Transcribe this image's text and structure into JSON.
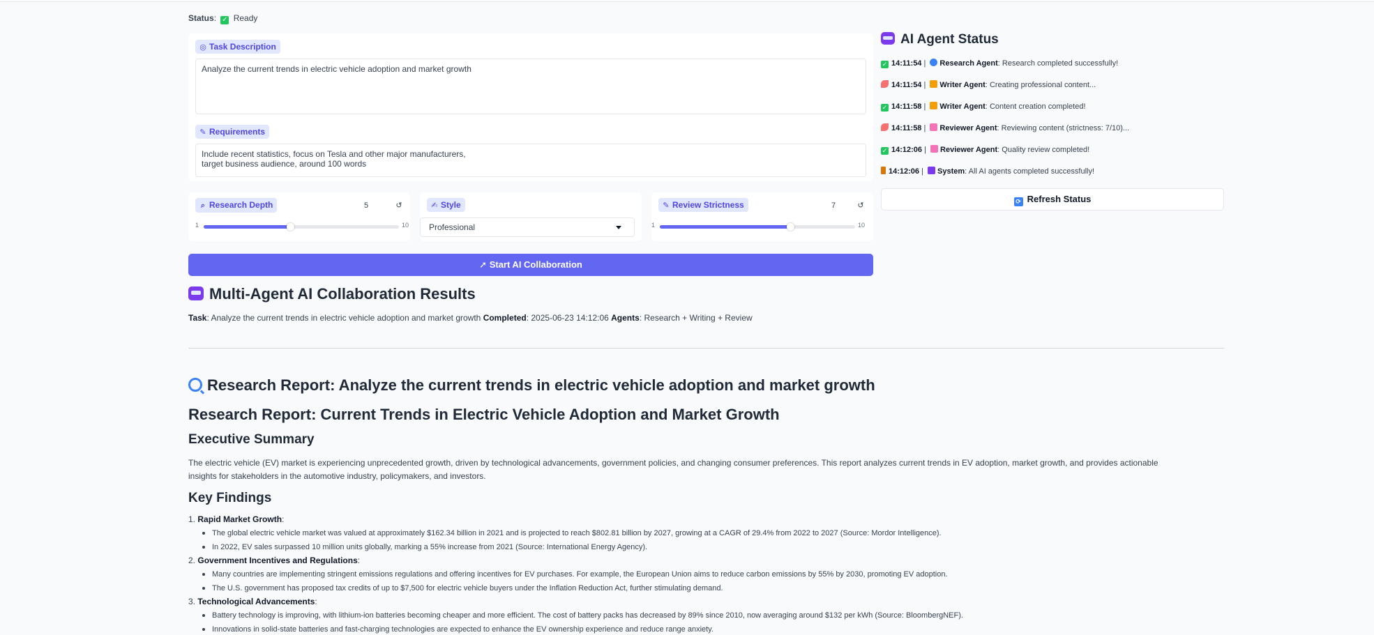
{
  "status": {
    "label": "Status",
    "value": "Ready",
    "icon": "checkmark-icon"
  },
  "task": {
    "label": "Task Description",
    "value": "Analyze the current trends in electric vehicle adoption and market growth"
  },
  "requirements": {
    "label": "Requirements",
    "line1": "Include recent statistics, focus on Tesla and other major manufacturers,",
    "line2": "target business audience, around 100 words"
  },
  "controls": {
    "research_depth": {
      "label": "Research Depth",
      "value": "5",
      "min": "1",
      "max": "10",
      "level": 5
    },
    "style": {
      "label": "Style",
      "selected": "Professional"
    },
    "review_strictness": {
      "label": "Review Strictness",
      "value": "7",
      "min": "1",
      "max": "10",
      "level": 7
    },
    "reset_icon": "↺"
  },
  "start_button": "Start AI Collaboration",
  "results": {
    "title": "Multi-Agent AI Collaboration Results",
    "task_label": "Task",
    "task_value": ": Analyze the current trends in electric vehicle adoption and market growth ",
    "completed_label": "Completed",
    "completed_value": ": 2025-06-23 14:12:06 ",
    "agents_label": "Agents",
    "agents_value": ": Research + Writing + Review"
  },
  "report": {
    "heading": "Research Report: Analyze the current trends in electric vehicle adoption and market growth",
    "title": "Research Report: Current Trends in Electric Vehicle Adoption and Market Growth",
    "exec_heading": "Executive Summary",
    "exec_text": "The electric vehicle (EV) market is experiencing unprecedented growth, driven by technological advancements, government policies, and changing consumer preferences. This report analyzes current trends in EV adoption, market growth, and provides actionable insights for stakeholders in the automotive industry, policymakers, and investors.",
    "findings_heading": "Key Findings",
    "findings": [
      {
        "num": "1.",
        "title": "Rapid Market Growth",
        "points": [
          "The global electric vehicle market was valued at approximately $162.34 billion in 2021 and is projected to reach $802.81 billion by 2027, growing at a CAGR of 29.4% from 2022 to 2027 (Source: Mordor Intelligence).",
          "In 2022, EV sales surpassed 10 million units globally, marking a 55% increase from 2021 (Source: International Energy Agency)."
        ]
      },
      {
        "num": "2.",
        "title": "Government Incentives and Regulations",
        "points": [
          "Many countries are implementing stringent emissions regulations and offering incentives for EV purchases. For example, the European Union aims to reduce carbon emissions by 55% by 2030, promoting EV adoption.",
          "The U.S. government has proposed tax credits of up to $7,500 for electric vehicle buyers under the Inflation Reduction Act, further stimulating demand."
        ]
      },
      {
        "num": "3.",
        "title": "Technological Advancements",
        "points": [
          "Battery technology is improving, with lithium-ion batteries becoming cheaper and more efficient. The cost of battery packs has decreased by 89% since 2010, now averaging around $132 per kWh (Source: BloombergNEF).",
          "Innovations in solid-state batteries and fast-charging technologies are expected to enhance the EV ownership experience and reduce range anxiety."
        ]
      }
    ]
  },
  "agent_status": {
    "title": "AI Agent Status",
    "log": [
      {
        "state": "ok",
        "time": "14:11:54",
        "agent_icon": "research",
        "agent": "Research Agent",
        "msg": ": Research completed successfully!"
      },
      {
        "state": "run",
        "time": "14:11:54",
        "agent_icon": "writer",
        "agent": "Writer Agent",
        "msg": ": Creating professional content..."
      },
      {
        "state": "ok",
        "time": "14:11:58",
        "agent_icon": "writer",
        "agent": "Writer Agent",
        "msg": ": Content creation completed!"
      },
      {
        "state": "run",
        "time": "14:11:58",
        "agent_icon": "reviewer",
        "agent": "Reviewer Agent",
        "msg": ": Reviewing content (strictness: 7/10)..."
      },
      {
        "state": "ok",
        "time": "14:12:06",
        "agent_icon": "reviewer",
        "agent": "Reviewer Agent",
        "msg": ": Quality review completed!"
      },
      {
        "state": "wait",
        "time": "14:12:06",
        "agent_icon": "system",
        "agent": "System",
        "msg": ": All AI agents completed successfully!"
      }
    ],
    "separator": " | ",
    "refresh_button": "Refresh Status"
  },
  "colors": {
    "accent": "#6366f1",
    "tag_bg": "#e0e7ff",
    "tag_text": "#4f46e5",
    "success": "#22c55e"
  }
}
